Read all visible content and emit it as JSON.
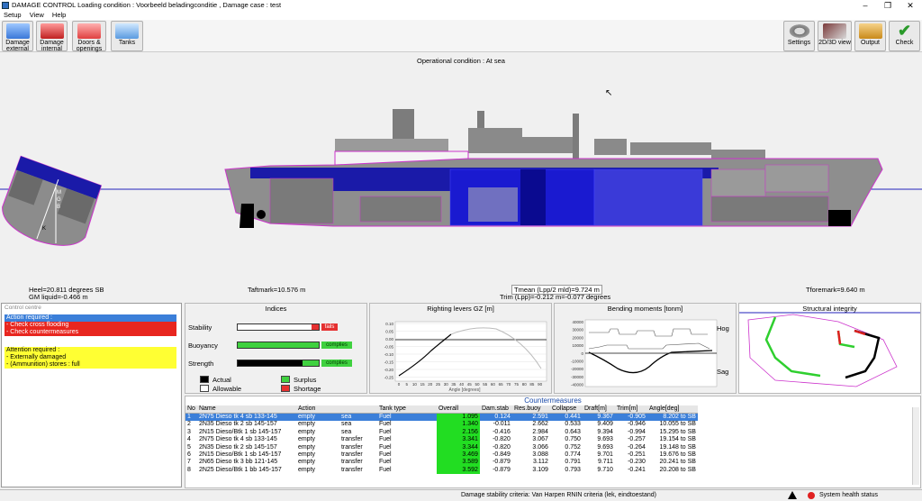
{
  "window": {
    "title": "DAMAGE CONTROL  Loading condition : Voorbeeld beladingconditie , Damage case : test"
  },
  "menu": [
    "Setup",
    "View",
    "Help"
  ],
  "toolbar_left": [
    {
      "label": "Damage external"
    },
    {
      "label": "Damage internal"
    },
    {
      "label": "Doors & openings"
    },
    {
      "label": "Tanks"
    }
  ],
  "toolbar_right": [
    {
      "label": "Settings"
    },
    {
      "label": "2D/3D view"
    },
    {
      "label": "Output"
    },
    {
      "label": "Check"
    }
  ],
  "view": {
    "op_condition": "Operational condition : At sea",
    "heel": "Heel=20.811 degrees SB",
    "gm": "GM liquid=-0.466 m",
    "taftmark": "Taftmark=10.576 m",
    "tmean": "Tmean (Lpp/2 mld)=9.724 m",
    "trim": "Trim (Lpp)=-0.212 m=-0.077 degrees",
    "tforemark": "Tforemark=9.640 m",
    "section_labels": {
      "m": "M",
      "g": "G",
      "b": "B",
      "k": "K"
    }
  },
  "control": {
    "title": "Control centre",
    "action_header": "Action required :",
    "actions": [
      "- Check cross flooding",
      "- Check countermeasures"
    ],
    "attention_header": "Attention required :",
    "attentions": [
      "- Externally damaged",
      "- (Ammunition) stores : full"
    ]
  },
  "indices": {
    "title": "Indices",
    "rows": [
      {
        "label": "Stability",
        "status": "fails"
      },
      {
        "label": "Buoyancy",
        "status": "complies"
      },
      {
        "label": "Strength",
        "status": "complies"
      }
    ],
    "legend": [
      "Actual",
      "Surplus",
      "Allowable",
      "Shortage"
    ]
  },
  "gz": {
    "title": "Righting levers GZ [m]",
    "yticks": [
      "0.10",
      "0.05",
      "0.00",
      "-0.05",
      "-0.10",
      "-0.15",
      "-0.20",
      "-0.25"
    ],
    "xticks": [
      "0",
      "5",
      "10",
      "15",
      "20",
      "25",
      "30",
      "35",
      "40",
      "45",
      "50",
      "55",
      "60",
      "65",
      "70",
      "75",
      "80",
      "85",
      "90"
    ],
    "xlabel": "Angle [degrees]"
  },
  "bending": {
    "title": "Bending moments [tonm]",
    "yticks": [
      "40000",
      "30000",
      "20000",
      "10000",
      "0",
      "-10000",
      "-20000",
      "-30000",
      "-40000"
    ],
    "hog": "Hog",
    "sag": "Sag"
  },
  "structural": {
    "title": "Structural integrity"
  },
  "countermeasures": {
    "title": "Countermeasures",
    "headers": [
      "No",
      "Name",
      "Action",
      "",
      "Tank type",
      "Overall",
      "Dam.stab",
      "Res.buoy",
      "Collapse",
      "Draft[m]",
      "Trim[m]",
      "Angle[deg]"
    ],
    "rows": [
      [
        "1",
        "2N75 Dieso tk 4 sb  133-145",
        "empty",
        "sea",
        "Fuel",
        "1.095",
        "0.124",
        "2.591",
        "0.441",
        "9.367",
        "-0.905",
        "8.202 to SB"
      ],
      [
        "2",
        "2N35 Dieso tk 2 sb  145-157",
        "empty",
        "sea",
        "Fuel",
        "1.340",
        "-0.011",
        "2.662",
        "0.533",
        "9.409",
        "-0.946",
        "10.055 to SB"
      ],
      [
        "3",
        "2N15 Dieso/Btk 1 sb  145-157",
        "empty",
        "sea",
        "Fuel",
        "2.156",
        "-0.416",
        "2.984",
        "0.643",
        "9.394",
        "-0.994",
        "15.295 to SB"
      ],
      [
        "4",
        "2N75 Dieso tk 4 sb  133-145",
        "empty",
        "transfer",
        "Fuel",
        "3.341",
        "-0.820",
        "3.067",
        "0.750",
        "9.693",
        "-0.257",
        "19.154 to SB"
      ],
      [
        "5",
        "2N35 Dieso tk 2 sb  145-157",
        "empty",
        "transfer",
        "Fuel",
        "3.344",
        "-0.820",
        "3.066",
        "0.752",
        "9.693",
        "-0.264",
        "19.148 to SB"
      ],
      [
        "6",
        "2N15 Dieso/Btk 1 sb  145-157",
        "empty",
        "transfer",
        "Fuel",
        "3.469",
        "-0.849",
        "3.088",
        "0.774",
        "9.701",
        "-0.251",
        "19.676 to SB"
      ],
      [
        "7",
        "2N65 Dieso tk 3 bb  121-145",
        "empty",
        "transfer",
        "Fuel",
        "3.589",
        "-0.879",
        "3.112",
        "0.791",
        "9.711",
        "-0.230",
        "20.241 to SB"
      ],
      [
        "8",
        "2N25 Dieso/Btk 1 bb  145-157",
        "empty",
        "transfer",
        "Fuel",
        "3.592",
        "-0.879",
        "3.109",
        "0.793",
        "9.710",
        "-0.241",
        "20.208 to SB"
      ]
    ]
  },
  "statusbar": {
    "criteria": "Damage stability criteria: Van Harpen RNIN criteria (lek, eindtoestand)",
    "health": "System health status"
  },
  "colors": {
    "selected_row": "#3b7fd9",
    "action_bg": "#e8261f",
    "attention_bg": "#ffff33",
    "overall_bg": "#22dd22"
  }
}
